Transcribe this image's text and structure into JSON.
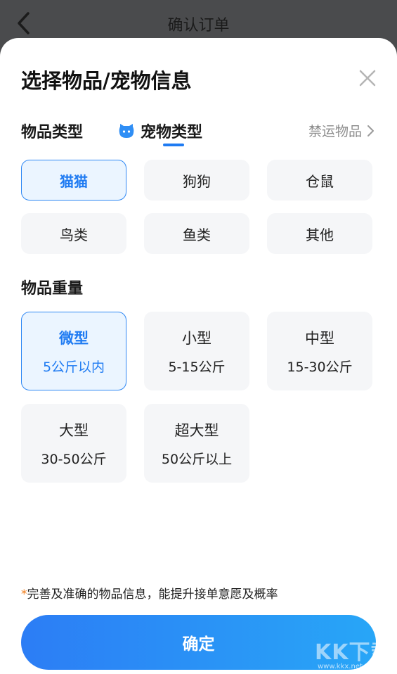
{
  "topbar": {
    "title": "确认订单"
  },
  "sheet": {
    "title": "选择物品/宠物信息",
    "tabs": [
      {
        "label": "物品类型",
        "selected": false
      },
      {
        "label": "宠物类型",
        "selected": true
      }
    ],
    "banned_link": "禁运物品",
    "pet_types": [
      {
        "label": "猫猫",
        "selected": true
      },
      {
        "label": "狗狗",
        "selected": false
      },
      {
        "label": "仓鼠",
        "selected": false
      },
      {
        "label": "鸟类",
        "selected": false
      },
      {
        "label": "鱼类",
        "selected": false
      },
      {
        "label": "其他",
        "selected": false
      }
    ],
    "weight_title": "物品重量",
    "weights": [
      {
        "name": "微型",
        "range": "5公斤以内",
        "selected": true
      },
      {
        "name": "小型",
        "range": "5-15公斤",
        "selected": false
      },
      {
        "name": "中型",
        "range": "15-30公斤",
        "selected": false
      },
      {
        "name": "大型",
        "range": "30-50公斤",
        "selected": false
      },
      {
        "name": "超大型",
        "range": "50公斤以上",
        "selected": false
      }
    ],
    "hint_star": "*",
    "hint": "完善及准确的物品信息，能提升接单意愿及概率",
    "confirm_label": "确定"
  },
  "watermark": {
    "main": "KK下载",
    "sub": "www.kkx.net"
  },
  "colors": {
    "accent": "#1f7bf2",
    "selected_bg": "#ebf5ff",
    "option_bg": "#f5f6f8",
    "hint_star": "#f07c1a"
  }
}
